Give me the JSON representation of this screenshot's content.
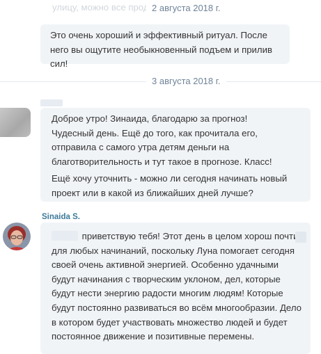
{
  "chat": {
    "top_faded_text": "улицу, можно все прод",
    "date_1": "2 августа 2018 г.",
    "date_2": "3 августа 2018 г.",
    "msg_1": "Это очень хороший и эффективный ритуал. После него вы ощутите необыкновенный подъем и прилив сил!",
    "msg_2_p1": "Доброе утро! Зинаида, благодарю за прогноз! Чудесный день. Ещё до того, как прочитала его, отправила с самого утра детям деньги на благотворительность и тут такое в прогнозе. Класс!",
    "msg_2_p2": "Ещё хочу уточнить - можно ли сегодня начинать новый проект или в какой из ближайших дней лучше?",
    "sender_name": "Sinaida S.",
    "msg_3": "приветствую тебя! Этот день в целом хорош почти для любых начинаний, поскольку Луна помогает сегодня своей очень активной энергией. Особенно удачными будут начинания с творческим уклоном, дел, которые будут нести энергию радости многим людям! Которые будут постоянно развиваться во всём многообразии. Дело в котором будет участвовать множество людей и будет постоянное движение и позитивные перемены."
  },
  "colors": {
    "bubble_bg": "#f1f4f7",
    "date_text": "#6f8399",
    "sender_text": "#3d7a9a"
  }
}
